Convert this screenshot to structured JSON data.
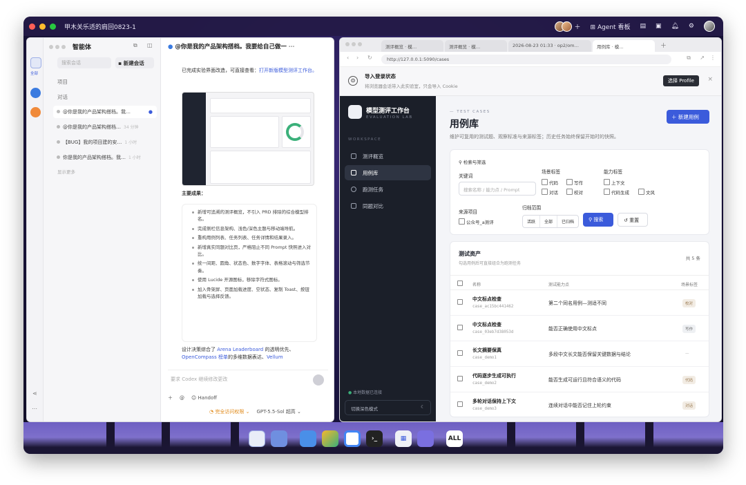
{
  "menubar": {
    "title": "甲木关乐适的肩回0823-1",
    "agent_label": "Agent 看板"
  },
  "left_app": {
    "agent_title": "智能体",
    "rail_label": "全部",
    "search_placeholder": "搜索会话",
    "new_chat": "新建会话",
    "section_projects": "项目",
    "section_chats": "对话",
    "chats": [
      {
        "title": "@你是我的产品架构搭档。我…",
        "time": ""
      },
      {
        "title": "@你是我的产品架构搭档…",
        "time": "34 分钟"
      },
      {
        "title": "【BUG】我的项目建的安…",
        "time": "1 小时"
      },
      {
        "title": "你是我的产品架构搭档。我…",
        "time": "1 小时"
      }
    ],
    "show_more": "显示更多",
    "chat_title": "@你是我的产品架构搭档。我要给自己做一",
    "intro_text": "已完成实验界面改造，可直接查看：",
    "intro_link": "打开新版模型测评工作台。",
    "results_heading": "主要成果：",
    "bullets": [
      "新增可追溯的测评概览，不引入 PRD 排除的综合模型排名。",
      "完成侧栏信息架构、浅色/深色主题与移动端导航。",
      "重构用例列表、任务列表、任务详情和结果录入。",
      "新增真实同题对比页，严格阻止不同 Prompt 快照进入对比。",
      "统一间距、圆角、状态色、数字字体、表格滚动与筛选节奏。",
      "使用 Lucide 开源图标，移除字符式图标。",
      "加入骨架屏、页面加载进度、空状态、复制 Toast、按钮加载与选择反馈。"
    ],
    "footer_text_a": "设计决策综合了",
    "footer_link_a": "Arena Leaderboard",
    "footer_text_b": "的透明优先、",
    "footer_link_b": "OpenCompass 榜单",
    "footer_text_c": "的多维数据表达、",
    "footer_link_c": "Vellum",
    "composer_placeholder": "要求 Codex 继续修改更改",
    "handoff": "Handoff",
    "status_access": "完全访问权限",
    "model": "GPT-5.5-Sol",
    "quality": "超高"
  },
  "browser": {
    "tabs": [
      "测评概览 · 模…",
      "测评概览 · 模…",
      "2026-08-23 01:33 · op2/om…",
      "用例库 · 模…"
    ],
    "url": "http://127.0.0.1:5090/cases",
    "banner_title": "导入登录状态",
    "banner_desc": "将浏览器会话带入此实验室，只会导入 Cookie",
    "banner_button": "选择 Profile"
  },
  "web_app": {
    "brand": "模型测评工作台",
    "brand_sub": "EVALUATION LAB",
    "workspace": "WORKSPACE",
    "nav": [
      "测评概览",
      "用例库",
      "跑测任务",
      "同题对比"
    ],
    "footer_status": "本地数据已连接",
    "theme_toggle": "切换深色模式",
    "eyebrow": "TEST CASES",
    "page_title": "用例库",
    "page_desc": "维护可复用的测试题、观察标准与来源标签；历史任务始终保留开始时的快照。",
    "new_case": "新建用例",
    "filter_title": "检索与筛选",
    "keyword_label": "关键词",
    "keyword_placeholder": "搜索名称 / 能力点 / Prompt",
    "scene_label": "场景标签",
    "scene_tags": [
      "代码",
      "写作",
      "对话",
      "校对"
    ],
    "ability_label": "能力标签",
    "ability_tags": [
      "上下文",
      "代码生成",
      "文风"
    ],
    "source_label": "来源项目",
    "source_option": "公众号_a测评",
    "archive_label": "归档范围",
    "archive_options": [
      "活跃",
      "全部",
      "已归档"
    ],
    "search_button": "搜索",
    "reset_button": "重置",
    "table_title": "测试资产",
    "table_sub": "勾选用例后可直接组合为跑测任务",
    "table_count": "共 5 条",
    "col_name": "名称",
    "col_point": "测试能力点",
    "col_tag": "场景标签",
    "rows": [
      {
        "name": "中文标点检查",
        "code": "case_ac15bc441462",
        "point": "第二个同名用例—测适不同",
        "tag": "校对"
      },
      {
        "name": "中文标点检查",
        "code": "case_03eb7d38053d",
        "point": "能否正确使用中文标点",
        "tag": "写作"
      },
      {
        "name": "长文摘要保真",
        "code": "case_demo1",
        "point": "多段中文长文能否保留关键数据与结论",
        "tag": "—"
      },
      {
        "name": "代码逐步生成可执行",
        "code": "case_demo2",
        "point": "能否生成可运行且符合语义的代码",
        "tag": "代码"
      },
      {
        "name": "多轮对话保持上下文",
        "code": "case_demo3",
        "point": "连续对话中能否记住上轮约束",
        "tag": "对话"
      }
    ]
  },
  "dock": {
    "all_label": "ALL"
  },
  "colors": {
    "accent": "#3b5bdb",
    "sidebar_dark": "#1b1f29",
    "desktop": "#2a1f5c"
  }
}
